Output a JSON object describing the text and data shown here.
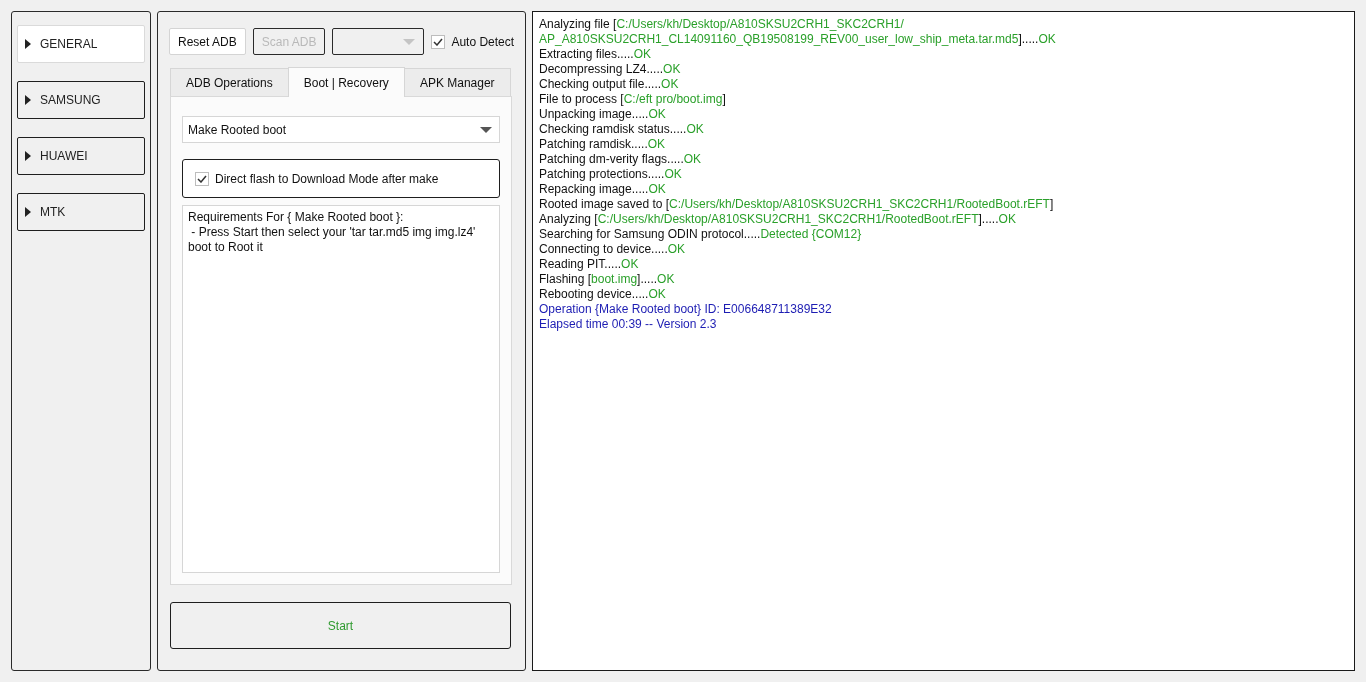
{
  "sidebar": {
    "items": [
      {
        "label": "GENERAL",
        "selected": true,
        "expanded": false
      },
      {
        "label": "SAMSUNG",
        "selected": false,
        "expanded": false
      },
      {
        "label": "HUAWEI",
        "selected": false,
        "expanded": false
      },
      {
        "label": "MTK",
        "selected": false,
        "expanded": false
      }
    ]
  },
  "toolbar": {
    "buttons": [
      {
        "label": "Reset ADB",
        "disabled": false
      },
      {
        "label": "Scan ADB",
        "disabled": true
      }
    ],
    "device_select": {
      "disabled": true
    },
    "auto_detect": {
      "label": "Auto Detect",
      "checked": true
    }
  },
  "tabs": [
    {
      "label": "ADB Operations",
      "selected": false
    },
    {
      "label": "Boot | Recovery",
      "selected": true
    },
    {
      "label": "APK Manager",
      "selected": false
    }
  ],
  "boot_recovery": {
    "operation_select": {
      "value": "Make Rooted boot"
    },
    "flash_option": {
      "label": "Direct flash to Download Mode after make",
      "checked": true
    },
    "requirements": {
      "value": "Requirements For { Make Rooted boot }:\n - Press Start then select your 'tar tar.md5 img img.lz4'\nboot to Root it"
    }
  },
  "start_button": {
    "label": "Start"
  },
  "log": {
    "lines": [
      {
        "segments": [
          {
            "kind": "text",
            "text": "Analyzing file ["
          },
          {
            "kind": "highlight",
            "text": "C:/Users/kh/Desktop/A810SKSU2CRH1_SKC2CRH1/"
          }
        ]
      },
      {
        "segments": [
          {
            "kind": "highlight",
            "text": "AP_A810SKSU2CRH1_CL14091160_QB19508199_REV00_user_low_ship_meta.tar.md5"
          },
          {
            "kind": "text",
            "text": "]....."
          },
          {
            "kind": "highlight",
            "text": "OK"
          }
        ]
      },
      {
        "segments": [
          {
            "kind": "text",
            "text": "Extracting files....."
          },
          {
            "kind": "highlight",
            "text": "OK"
          }
        ]
      },
      {
        "segments": [
          {
            "kind": "text",
            "text": "Decompressing LZ4....."
          },
          {
            "kind": "highlight",
            "text": "OK"
          }
        ]
      },
      {
        "segments": [
          {
            "kind": "text",
            "text": "Checking output file....."
          },
          {
            "kind": "highlight",
            "text": "OK"
          }
        ]
      },
      {
        "segments": [
          {
            "kind": "text",
            "text": "File to process ["
          },
          {
            "kind": "highlight",
            "text": "C:/eft pro/boot.img"
          },
          {
            "kind": "text",
            "text": "]"
          }
        ]
      },
      {
        "segments": [
          {
            "kind": "text",
            "text": "Unpacking image....."
          },
          {
            "kind": "highlight",
            "text": "OK"
          }
        ]
      },
      {
        "segments": [
          {
            "kind": "text",
            "text": "Checking ramdisk status....."
          },
          {
            "kind": "highlight",
            "text": "OK"
          }
        ]
      },
      {
        "segments": [
          {
            "kind": "text",
            "text": "Patching ramdisk....."
          },
          {
            "kind": "highlight",
            "text": "OK"
          }
        ]
      },
      {
        "segments": [
          {
            "kind": "text",
            "text": "Patching dm-verity flags....."
          },
          {
            "kind": "highlight",
            "text": "OK"
          }
        ]
      },
      {
        "segments": [
          {
            "kind": "text",
            "text": "Patching protections....."
          },
          {
            "kind": "highlight",
            "text": "OK"
          }
        ]
      },
      {
        "segments": [
          {
            "kind": "text",
            "text": "Repacking image....."
          },
          {
            "kind": "highlight",
            "text": "OK"
          }
        ]
      },
      {
        "segments": [
          {
            "kind": "text",
            "text": "Rooted image saved to ["
          },
          {
            "kind": "highlight",
            "text": "C:/Users/kh/Desktop/A810SKSU2CRH1_SKC2CRH1/RootedBoot.rEFT"
          },
          {
            "kind": "text",
            "text": "]"
          }
        ]
      },
      {
        "segments": [
          {
            "kind": "text",
            "text": "Analyzing ["
          },
          {
            "kind": "highlight",
            "text": "C:/Users/kh/Desktop/A810SKSU2CRH1_SKC2CRH1/RootedBoot.rEFT"
          },
          {
            "kind": "text",
            "text": "]....."
          },
          {
            "kind": "highlight",
            "text": "OK"
          }
        ]
      },
      {
        "segments": [
          {
            "kind": "text",
            "text": "Searching for Samsung ODIN protocol....."
          },
          {
            "kind": "highlight",
            "text": "Detected {COM12}"
          }
        ]
      },
      {
        "segments": [
          {
            "kind": "text",
            "text": "Connecting to device....."
          },
          {
            "kind": "highlight",
            "text": "OK"
          }
        ]
      },
      {
        "segments": [
          {
            "kind": "text",
            "text": "Reading PIT....."
          },
          {
            "kind": "highlight",
            "text": "OK"
          }
        ]
      },
      {
        "segments": [
          {
            "kind": "text",
            "text": "Flashing ["
          },
          {
            "kind": "highlight",
            "text": "boot.img"
          },
          {
            "kind": "text",
            "text": "]....."
          },
          {
            "kind": "highlight",
            "text": "OK"
          }
        ]
      },
      {
        "segments": [
          {
            "kind": "text",
            "text": "Rebooting device....."
          },
          {
            "kind": "highlight",
            "text": "OK"
          }
        ]
      },
      {
        "segments": [
          {
            "kind": "summary",
            "text": "Operation {Make Rooted boot} ID: E006648711389E32"
          }
        ]
      },
      {
        "segments": [
          {
            "kind": "summary",
            "text": "Elapsed time 00:39 -- Version 2.3"
          }
        ]
      }
    ]
  }
}
